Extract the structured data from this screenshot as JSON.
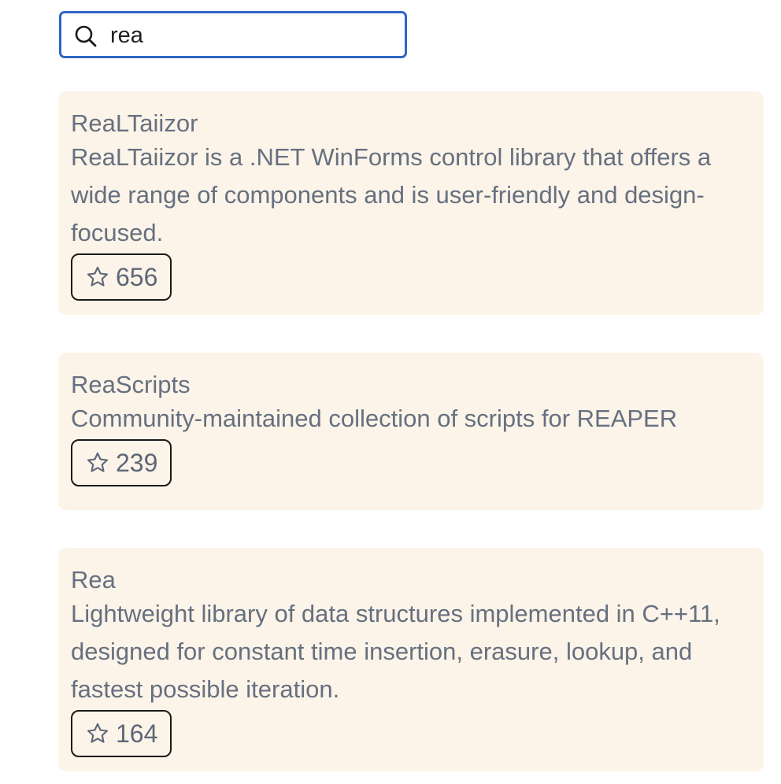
{
  "search": {
    "value": "rea",
    "icon": "search-icon"
  },
  "results": [
    {
      "title": "ReaLTaiizor",
      "description": "ReaLTaiizor is a .NET WinForms control library that offers a wide range of components and is user-friendly and design-focused.",
      "stars": "656"
    },
    {
      "title": "ReaScripts",
      "description": "Community-maintained collection of scripts for REAPER",
      "stars": "239"
    },
    {
      "title": "Rea",
      "description": "Lightweight library of data structures implemented in C++11, designed for constant time insertion, erasure, lookup, and fastest possible iteration.",
      "stars": "164"
    }
  ],
  "colors": {
    "search_border": "#2f66c4",
    "card_background": "#fcf4e8",
    "text": "#667080",
    "badge_border": "#1a1a1a"
  }
}
